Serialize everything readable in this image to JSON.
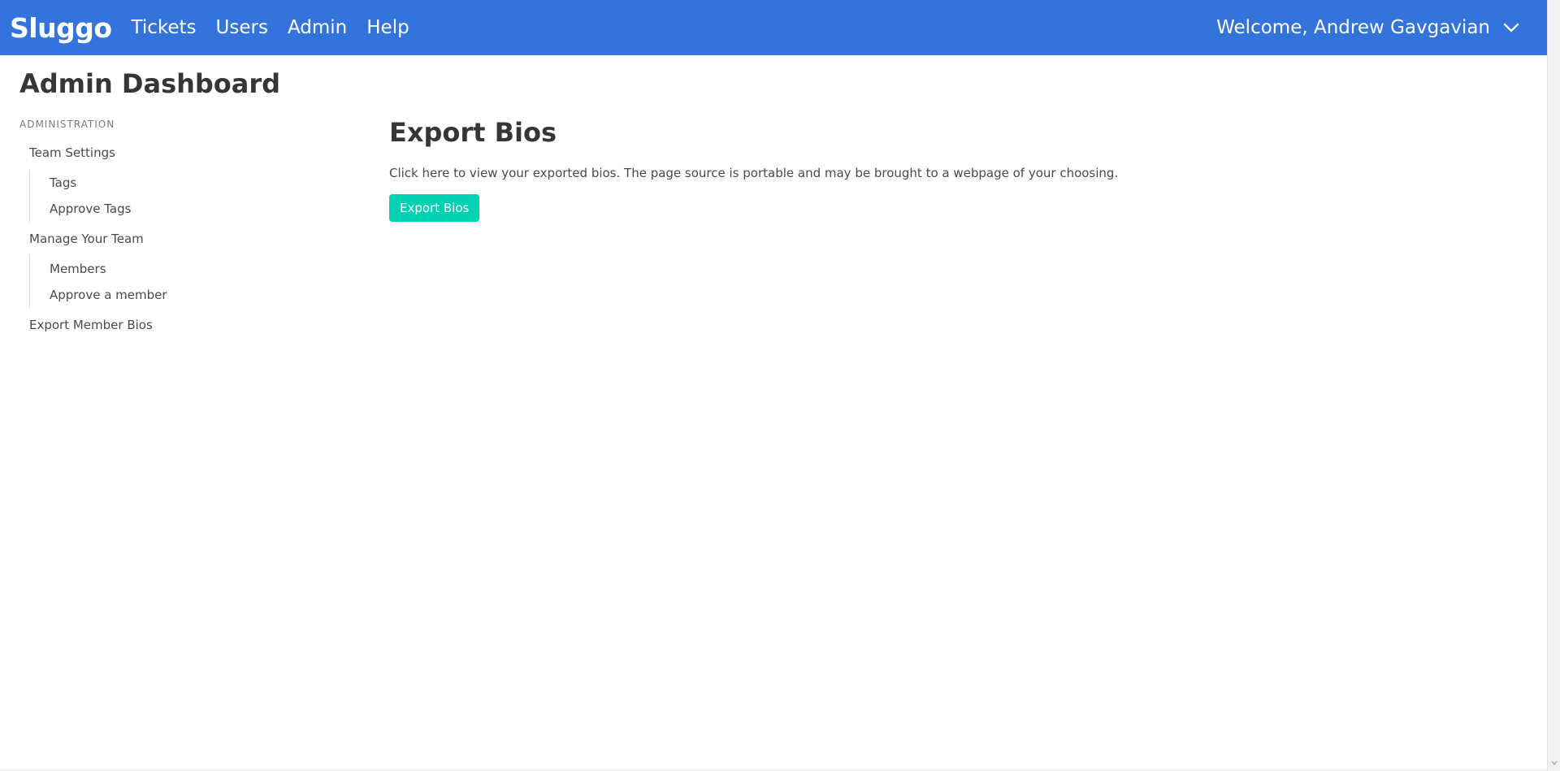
{
  "navbar": {
    "brand": "Sluggo",
    "links": [
      "Tickets",
      "Users",
      "Admin",
      "Help"
    ],
    "user_greeting": "Welcome, Andrew Gavgavian",
    "background_color": "#3273dc"
  },
  "page_title": "Admin Dashboard",
  "sidebar": {
    "label": "ADMINISTRATION",
    "sections": [
      {
        "title": "Team Settings",
        "items": [
          "Tags",
          "Approve Tags"
        ]
      },
      {
        "title": "Manage Your Team",
        "items": [
          "Members",
          "Approve a member"
        ]
      },
      {
        "title": "Export Member Bios",
        "items": []
      }
    ]
  },
  "main": {
    "title": "Export Bios",
    "description": "Click here to view your exported bios. The page source is portable and may be brought to a webpage of your choosing.",
    "button_label": "Export Bios",
    "button_color": "#00d1b2"
  }
}
